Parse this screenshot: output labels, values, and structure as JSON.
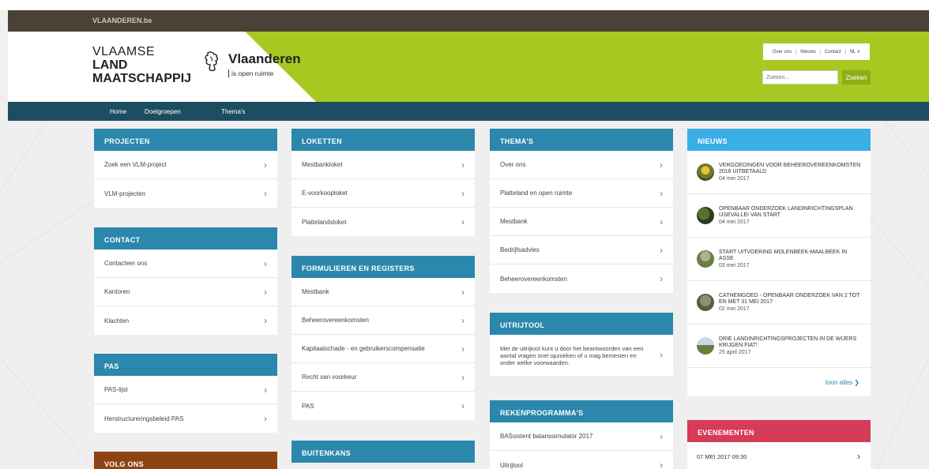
{
  "gov_bar": {
    "link": "VLAANDEREN.be"
  },
  "logo": {
    "line1": "VLAAMSE",
    "line2": "LAND",
    "line3": "MAATSCHAPPIJ"
  },
  "vlaanderen": {
    "name": "Vlaanderen",
    "tagline": "is open ruimte"
  },
  "toplinks": [
    "Over ons",
    "Nieuws",
    "Contact",
    "NL ∨"
  ],
  "search": {
    "placeholder": "Zoeken...",
    "button": "Zoeken"
  },
  "nav": [
    "Home",
    "Doelgroepen",
    "Thema's"
  ],
  "col1": {
    "projecten": {
      "title": "PROJECTEN",
      "items": [
        "Zoek een VLM-project",
        "VLM-projecten"
      ]
    },
    "contact": {
      "title": "CONTACT",
      "items": [
        "Contacteer ons",
        "Kantoren",
        "Klachten"
      ]
    },
    "pas": {
      "title": "PAS",
      "items": [
        "PAS-lijst",
        "Herstructureringsbeleid PAS"
      ]
    },
    "volg": {
      "title": "VOLG ONS"
    }
  },
  "col2": {
    "loketten": {
      "title": "LOKETTEN",
      "items": [
        "Mestbankloket",
        "E-voorkooploket",
        "Plattelandsloket"
      ]
    },
    "formulieren": {
      "title": "FORMULIEREN EN REGISTERS",
      "items": [
        "Mestbank",
        "Beheerovereenkomsten",
        "Kapitaalschade - en gebruikerscompensatie",
        "Recht van voorkeur",
        "PAS"
      ]
    },
    "buitenkans": {
      "title": "BUITENKANS"
    }
  },
  "col3": {
    "themas": {
      "title": "THEMA'S",
      "items": [
        "Over ons",
        "Platteland en open ruimte",
        "Mestbank",
        "Bedrijfsadvies",
        "Beheerovereenkomsten"
      ]
    },
    "uitrijtool": {
      "title": "UITRIJTOOL",
      "text": "Met de uitrijtool kunt u door het beantwoorden van een aantal vragen snel opzoeken of u mag bemesten en onder welke voorwaarden."
    },
    "rekenprogrammas": {
      "title": "REKENPROGRAMMA'S",
      "items": [
        "BASsistent balanssimulator 2017",
        "Uitrijtool"
      ]
    }
  },
  "col4": {
    "nieuws": {
      "title": "NIEUWS",
      "items": [
        {
          "title": "Vergoedingen voor beheerovereenkomsten 2016 uitbetaald",
          "date": "04 mei 2017"
        },
        {
          "title": "Openbaar onderzoek landinrichtingsplan IJsevallei van start",
          "date": "04 mei 2017"
        },
        {
          "title": "Start uitvoering Molenbeek-Maalbeek in Asse",
          "date": "03 mei 2017"
        },
        {
          "title": "Cathemgoed - openbaar onderzoek van 2 tot en met 31 mei 2017",
          "date": "02 mei 2017"
        },
        {
          "title": "Drie landinrichtingsprojecten in de Wijers krijgen fiat!",
          "date": "25 april 2017"
        }
      ],
      "more": "toon alles ❯"
    },
    "evenementen": {
      "title": "EVENEMENTEN",
      "items": [
        "07 MEI 2017 09:30"
      ]
    }
  },
  "colors": {
    "green": "#a8c721",
    "navy": "#1d4d61",
    "blue": "#2b87ab",
    "cyan": "#3aafe6",
    "brown": "#8e4412",
    "red": "#d63b57"
  }
}
